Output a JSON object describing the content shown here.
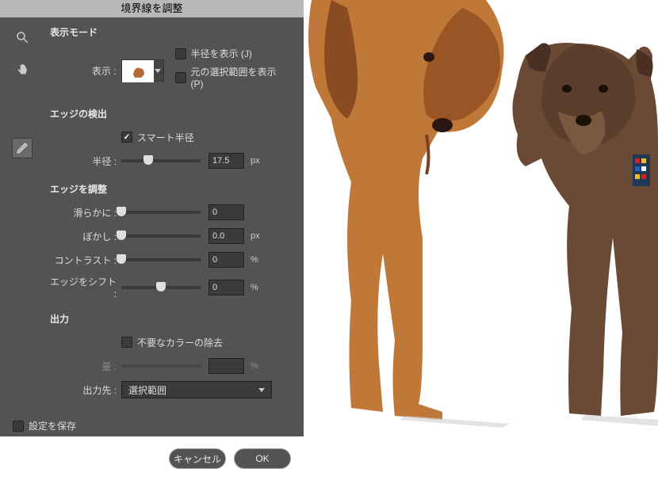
{
  "title": "境界線を調整",
  "display_mode": {
    "section": "表示モード",
    "view_label": "表示 :",
    "show_radius": {
      "label": "半径を表示 (J)",
      "checked": false
    },
    "show_original": {
      "label": "元の選択範囲を表示 (P)",
      "checked": false
    }
  },
  "edge_detect": {
    "section": "エッジの検出",
    "smart_radius": {
      "label": "スマート半径",
      "checked": true
    },
    "radius": {
      "label": "半径 :",
      "value": "17.5",
      "unit": "px",
      "pos": 34
    }
  },
  "edge_adjust": {
    "section": "エッジを調整",
    "smooth": {
      "label": "滑らかに :",
      "value": "0",
      "unit": "",
      "pos": 0
    },
    "feather": {
      "label": "ぼかし :",
      "value": "0.0",
      "unit": "px",
      "pos": 0
    },
    "contrast": {
      "label": "コントラスト :",
      "value": "0",
      "unit": "%",
      "pos": 0
    },
    "shift": {
      "label": "エッジをシフト :",
      "value": "0",
      "unit": "%",
      "pos": 50
    }
  },
  "output": {
    "section": "出力",
    "decontaminate": {
      "label": "不要なカラーの除去",
      "checked": false
    },
    "amount": {
      "label": "量 :",
      "value": "",
      "unit": "%"
    },
    "output_to": {
      "label": "出力先 :",
      "value": "選択範囲"
    }
  },
  "save_settings": {
    "label": "設定を保存",
    "checked": false
  },
  "buttons": {
    "cancel": "キャンセル",
    "ok": "OK"
  }
}
